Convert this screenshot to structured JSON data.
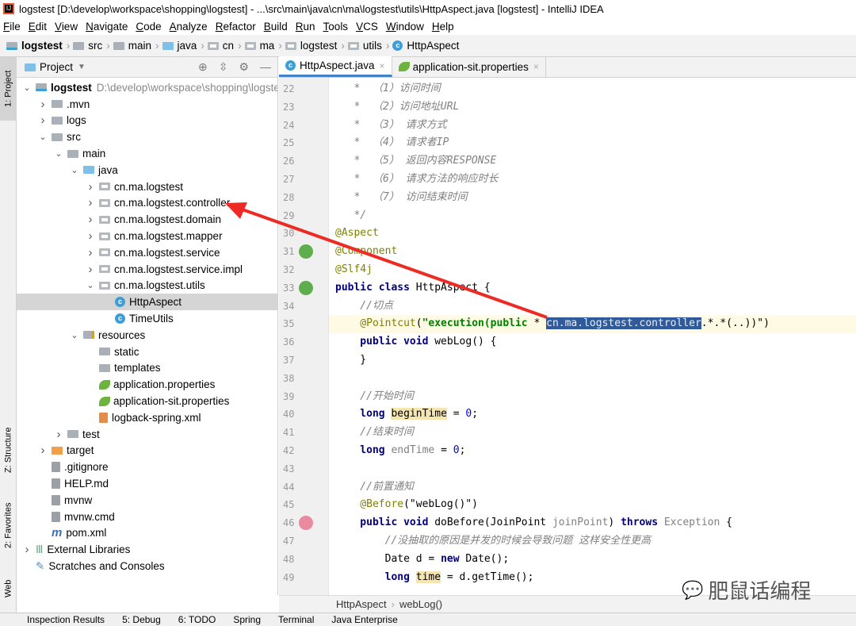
{
  "window": {
    "title": "logstest [D:\\develop\\workspace\\shopping\\logstest] - ...\\src\\main\\java\\cn\\ma\\logstest\\utils\\HttpAspect.java [logstest] - IntelliJ IDEA"
  },
  "menu": [
    "File",
    "Edit",
    "View",
    "Navigate",
    "Code",
    "Analyze",
    "Refactor",
    "Build",
    "Run",
    "Tools",
    "VCS",
    "Window",
    "Help"
  ],
  "breadcrumb": [
    {
      "label": "logstest",
      "icon": "module"
    },
    {
      "label": "src",
      "icon": "folder"
    },
    {
      "label": "main",
      "icon": "folder"
    },
    {
      "label": "java",
      "icon": "source-folder"
    },
    {
      "label": "cn",
      "icon": "package"
    },
    {
      "label": "ma",
      "icon": "package"
    },
    {
      "label": "logstest",
      "icon": "package"
    },
    {
      "label": "utils",
      "icon": "package"
    },
    {
      "label": "HttpAspect",
      "icon": "class"
    }
  ],
  "left_stripe": {
    "project": "1: Project",
    "structure": "Z: Structure",
    "favorites": "2: Favorites",
    "web": "Web"
  },
  "project_panel": {
    "title": "Project",
    "tree": [
      {
        "label": "logstest",
        "path": "D:\\develop\\workspace\\shopping\\logstest",
        "depth": 0,
        "arrow": "down",
        "icon": "module",
        "bold": true
      },
      {
        "label": ".mvn",
        "depth": 1,
        "arrow": "right",
        "icon": "folder"
      },
      {
        "label": "logs",
        "depth": 1,
        "arrow": "right",
        "icon": "folder"
      },
      {
        "label": "src",
        "depth": 1,
        "arrow": "down",
        "icon": "folder"
      },
      {
        "label": "main",
        "depth": 2,
        "arrow": "down",
        "icon": "folder"
      },
      {
        "label": "java",
        "depth": 3,
        "arrow": "down",
        "icon": "source-folder"
      },
      {
        "label": "cn.ma.logstest",
        "depth": 4,
        "arrow": "right",
        "icon": "package"
      },
      {
        "label": "cn.ma.logstest.controller",
        "depth": 4,
        "arrow": "right",
        "icon": "package"
      },
      {
        "label": "cn.ma.logstest.domain",
        "depth": 4,
        "arrow": "right",
        "icon": "package"
      },
      {
        "label": "cn.ma.logstest.mapper",
        "depth": 4,
        "arrow": "right",
        "icon": "package"
      },
      {
        "label": "cn.ma.logstest.service",
        "depth": 4,
        "arrow": "right",
        "icon": "package"
      },
      {
        "label": "cn.ma.logstest.service.impl",
        "depth": 4,
        "arrow": "right",
        "icon": "package"
      },
      {
        "label": "cn.ma.logstest.utils",
        "depth": 4,
        "arrow": "down",
        "icon": "package"
      },
      {
        "label": "HttpAspect",
        "depth": 5,
        "arrow": "",
        "icon": "class",
        "selected": true
      },
      {
        "label": "TimeUtils",
        "depth": 5,
        "arrow": "",
        "icon": "class"
      },
      {
        "label": "resources",
        "depth": 3,
        "arrow": "down",
        "icon": "resources-folder"
      },
      {
        "label": "static",
        "depth": 4,
        "arrow": "",
        "icon": "folder"
      },
      {
        "label": "templates",
        "depth": 4,
        "arrow": "",
        "icon": "folder"
      },
      {
        "label": "application.properties",
        "depth": 4,
        "arrow": "",
        "icon": "spring-properties"
      },
      {
        "label": "application-sit.properties",
        "depth": 4,
        "arrow": "",
        "icon": "spring-properties"
      },
      {
        "label": "logback-spring.xml",
        "depth": 4,
        "arrow": "",
        "icon": "xml-file"
      },
      {
        "label": "test",
        "depth": 2,
        "arrow": "right",
        "icon": "folder"
      },
      {
        "label": "target",
        "depth": 1,
        "arrow": "right",
        "icon": "excluded-folder"
      },
      {
        "label": ".gitignore",
        "depth": 1,
        "arrow": "",
        "icon": "text-file"
      },
      {
        "label": "HELP.md",
        "depth": 1,
        "arrow": "",
        "icon": "markdown-file"
      },
      {
        "label": "mvnw",
        "depth": 1,
        "arrow": "",
        "icon": "text-file"
      },
      {
        "label": "mvnw.cmd",
        "depth": 1,
        "arrow": "",
        "icon": "text-file"
      },
      {
        "label": "pom.xml",
        "depth": 1,
        "arrow": "",
        "icon": "maven-file"
      },
      {
        "label": "External Libraries",
        "depth": 0,
        "arrow": "right",
        "icon": "libraries"
      },
      {
        "label": "Scratches and Consoles",
        "depth": 0,
        "arrow": "",
        "icon": "scratches"
      }
    ]
  },
  "editor": {
    "tabs": [
      {
        "label": "HttpAspect.java",
        "icon": "class",
        "active": true
      },
      {
        "label": "application-sit.properties",
        "icon": "spring-properties",
        "active": false
      }
    ],
    "current_line": 35,
    "lines": [
      {
        "n": 22,
        "t": [
          [
            "cm",
            "   *  （1）访问时间"
          ]
        ]
      },
      {
        "n": 23,
        "t": [
          [
            "cm",
            "   *  （2）访问地址URL"
          ]
        ]
      },
      {
        "n": 24,
        "t": [
          [
            "cm",
            "   *  （3） 请求方式"
          ]
        ]
      },
      {
        "n": 25,
        "t": [
          [
            "cm",
            "   *  （4） 请求者IP"
          ]
        ]
      },
      {
        "n": 26,
        "t": [
          [
            "cm",
            "   *  （5） 返回内容RESPONSE"
          ]
        ]
      },
      {
        "n": 27,
        "t": [
          [
            "cm",
            "   *  （6） 请求方法的响应时长"
          ]
        ]
      },
      {
        "n": 28,
        "t": [
          [
            "cm",
            "   *  （7） 访问结束时间"
          ]
        ]
      },
      {
        "n": 29,
        "t": [
          [
            "cm",
            "   */"
          ]
        ]
      },
      {
        "n": 30,
        "t": [
          [
            "an",
            "@Aspect"
          ]
        ]
      },
      {
        "n": 31,
        "t": [
          [
            "an",
            "@Component"
          ]
        ],
        "gutter": "spring-bean-icon"
      },
      {
        "n": 32,
        "t": [
          [
            "an",
            "@Slf4j"
          ]
        ]
      },
      {
        "n": 33,
        "t": [
          [
            "kw",
            "public class "
          ],
          [
            "",
            "HttpAspect {"
          ]
        ],
        "gutter": "spring-class-icon"
      },
      {
        "n": 34,
        "t": [
          [
            "cm",
            "    //切点"
          ]
        ]
      },
      {
        "n": 35,
        "t": [
          [
            "an",
            "    @Pointcut"
          ],
          [
            "",
            "("
          ],
          [
            "str",
            "\"execution(public "
          ],
          [
            "",
            "* "
          ],
          [
            "sel2",
            "cn.ma.logstest.controller"
          ],
          [
            "",
            ".*.*(..))\")"
          ]
        ]
      },
      {
        "n": 36,
        "t": [
          [
            "kw",
            "    public void "
          ],
          [
            "",
            "webLog() {"
          ]
        ]
      },
      {
        "n": 37,
        "t": [
          [
            "",
            "    }"
          ]
        ]
      },
      {
        "n": 38,
        "t": [
          [
            "",
            ""
          ]
        ]
      },
      {
        "n": 39,
        "t": [
          [
            "cm",
            "    //开始时间"
          ]
        ]
      },
      {
        "n": 40,
        "t": [
          [
            "kw",
            "    long "
          ],
          [
            "hl",
            "beginTime"
          ],
          [
            "",
            " = "
          ],
          [
            "num",
            "0"
          ],
          [
            "",
            ";"
          ]
        ]
      },
      {
        "n": 41,
        "t": [
          [
            "cm",
            "    //结束时间"
          ]
        ]
      },
      {
        "n": 42,
        "t": [
          [
            "kw",
            "    long "
          ],
          [
            "gray",
            "endTime"
          ],
          [
            "",
            " = "
          ],
          [
            "num",
            "0"
          ],
          [
            "",
            ";"
          ]
        ]
      },
      {
        "n": 43,
        "t": [
          [
            "",
            ""
          ]
        ]
      },
      {
        "n": 44,
        "t": [
          [
            "cm",
            "    //前置通知"
          ]
        ]
      },
      {
        "n": 45,
        "t": [
          [
            "an",
            "    @Before"
          ],
          [
            "",
            "(\"webLog()\")"
          ]
        ]
      },
      {
        "n": 46,
        "t": [
          [
            "kw",
            "    public void "
          ],
          [
            "",
            "doBefore(JoinPoint "
          ],
          [
            "gray",
            "joinPoint"
          ],
          [
            "",
            ") "
          ],
          [
            "kw",
            "throws "
          ],
          [
            "gray",
            "Exception"
          ],
          [
            "",
            " {"
          ]
        ],
        "gutter": "method-icon"
      },
      {
        "n": 47,
        "t": [
          [
            "cm",
            "        //没抽取的原因是并发的时候会导致问题 这样安全性更高"
          ]
        ]
      },
      {
        "n": 48,
        "t": [
          [
            "",
            "        Date d = "
          ],
          [
            "kw",
            "new "
          ],
          [
            "",
            "Date();"
          ]
        ]
      },
      {
        "n": 49,
        "t": [
          [
            "kw",
            "        long "
          ],
          [
            "hl",
            "time"
          ],
          [
            "",
            " = d.getTime();"
          ]
        ]
      }
    ]
  },
  "editor_breadcrumb": [
    "HttpAspect",
    "webLog()"
  ],
  "bottom_tools": [
    "Inspection Results",
    "5: Debug",
    "6: TODO",
    "Spring",
    "Terminal",
    "Java Enterprise"
  ],
  "watermark": "肥鼠话编程",
  "colors": {
    "selection": "#2f5a9c",
    "annotation_arrow": "#ee2a24",
    "active_tab": "#4083c9"
  }
}
